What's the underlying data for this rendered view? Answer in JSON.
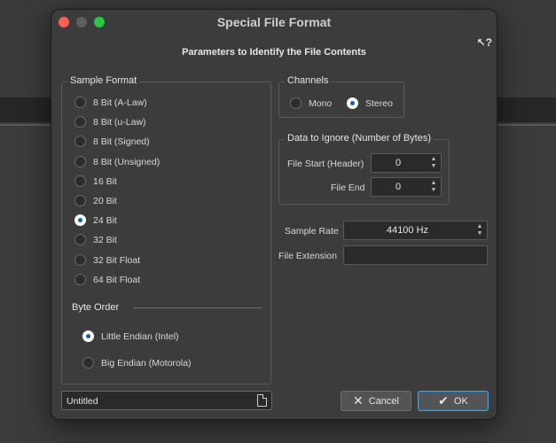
{
  "dialog": {
    "title": "Special File Format",
    "subtitle": "Parameters to Identify the File Contents",
    "help_icon": "?"
  },
  "sample_format": {
    "title": "Sample Format",
    "options": [
      "8 Bit (A-Law)",
      "8 Bit (u-Law)",
      "8 Bit (Signed)",
      "8 Bit (Unsigned)",
      "16 Bit",
      "20 Bit",
      "24 Bit",
      "32 Bit",
      "32 Bit Float",
      "64 Bit Float"
    ],
    "selected": "24 Bit"
  },
  "byte_order": {
    "title": "Byte Order",
    "options": [
      "Little Endian (Intel)",
      "Big Endian (Motorola)"
    ],
    "selected": "Little Endian (Intel)"
  },
  "channels": {
    "title": "Channels",
    "options": [
      "Mono",
      "Stereo"
    ],
    "selected": "Stereo"
  },
  "data_to_ignore": {
    "title": "Data to Ignore (Number of Bytes)",
    "file_start_label": "File Start (Header)",
    "file_start_value": "0",
    "file_end_label": "File End",
    "file_end_value": "0"
  },
  "sample_rate": {
    "label": "Sample Rate",
    "value": "44100 Hz"
  },
  "file_extension": {
    "label": "File Extension",
    "value": ""
  },
  "name_field": {
    "value": "Untitled"
  },
  "buttons": {
    "cancel_label": "Cancel",
    "ok_label": "OK"
  },
  "icons": {
    "cancel": "close-x-icon",
    "ok": "checkmark-icon",
    "document": "document-icon"
  }
}
